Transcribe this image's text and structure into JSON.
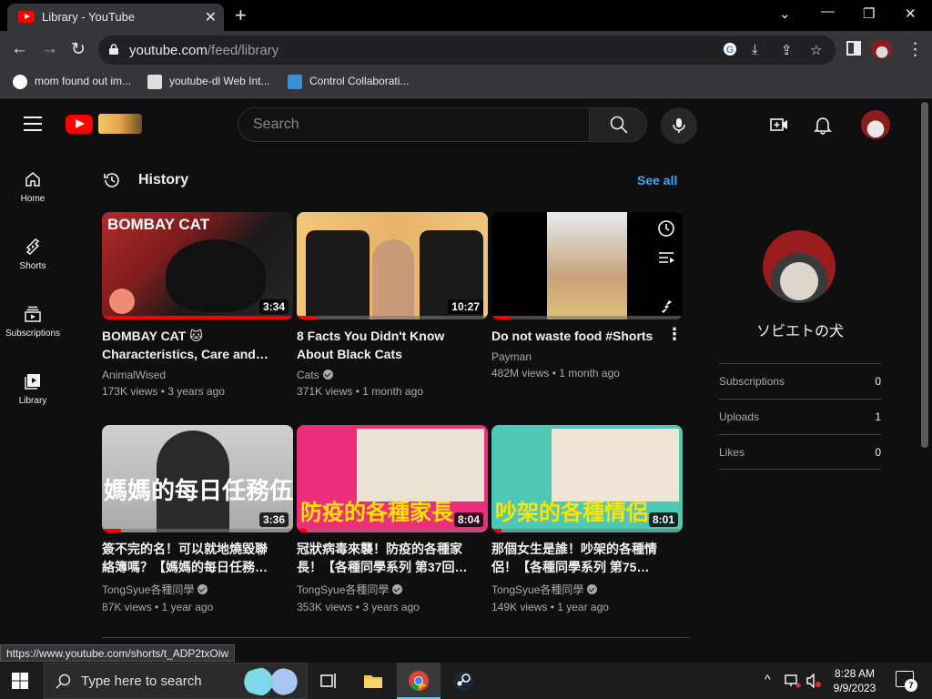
{
  "browser": {
    "tab_title": "Library - YouTube",
    "url_host": "youtube.com",
    "url_path": "/feed/library",
    "bookmarks": [
      {
        "label": "mom found out im..."
      },
      {
        "label": "youtube-dl Web Int..."
      },
      {
        "label": "Control Collaborati..."
      }
    ],
    "status_url": "https://www.youtube.com/shorts/t_ADP2txOiw"
  },
  "youtube": {
    "search_placeholder": "Search",
    "guide": [
      {
        "label": "Home"
      },
      {
        "label": "Shorts"
      },
      {
        "label": "Subscriptions"
      },
      {
        "label": "Library"
      }
    ],
    "history": {
      "title": "History",
      "see_all": "See all",
      "videos": [
        {
          "title": "BOMBAY CAT 🐱 Characteristics, Care and…",
          "channel": "AnimalWised",
          "verified": false,
          "meta": "173K views • 3 years ago",
          "duration": "3:34",
          "progress": 1.0,
          "thumb_text": "BOMBAY CAT"
        },
        {
          "title": "8 Facts You Didn't Know About Black Cats",
          "channel": "Cats",
          "verified": true,
          "meta": "371K views • 1 month ago",
          "duration": "10:27",
          "progress": 0.1
        },
        {
          "title": "Do not waste food #Shorts",
          "channel": "Payman",
          "verified": false,
          "meta": "482M views • 1 month ago",
          "duration": "",
          "progress": 0.1
        },
        {
          "title": "簽不完的名！可以就地燒毀聯絡簿嗎？【媽媽的每日任務…",
          "channel": "TongSyue各種同學",
          "verified": true,
          "meta": "87K views • 1 year ago",
          "duration": "3:36",
          "progress": 0.1,
          "thumb_text": "媽媽的每日任務伍"
        },
        {
          "title": "冠狀病毒來襲！防疫的各種家長！【各種同學系列 第37回…",
          "channel": "TongSyue各種同學",
          "verified": true,
          "meta": "353K views • 3 years ago",
          "duration": "8:04",
          "progress": 0.05,
          "thumb_text": "防疫的各種家長"
        },
        {
          "title": "那個女生是誰！吵架的各種情侶！【各種同學系列 第75…",
          "channel": "TongSyue各種同學",
          "verified": true,
          "meta": "149K views • 1 year ago",
          "duration": "8:01",
          "progress": 0.05,
          "thumb_text": "吵架的各種情侶"
        }
      ]
    },
    "profile": {
      "name": "ソビエトの犬",
      "stats": [
        {
          "label": "Subscriptions",
          "value": "0"
        },
        {
          "label": "Uploads",
          "value": "1"
        },
        {
          "label": "Likes",
          "value": "0"
        }
      ]
    }
  },
  "taskbar": {
    "search_placeholder": "Type here to search",
    "time": "8:28 AM",
    "date": "9/9/2023",
    "notification_count": "7"
  }
}
